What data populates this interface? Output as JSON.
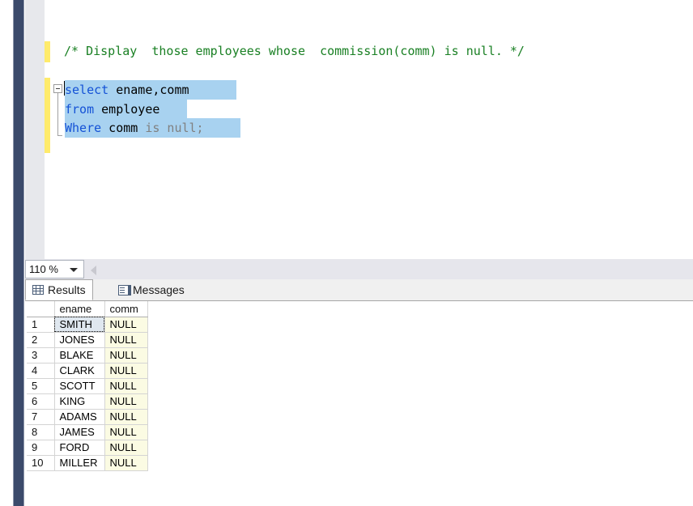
{
  "editor": {
    "comment": "/* Display  those employees whose  commission(comm) is null. */",
    "lines": [
      {
        "kw": "select",
        "rest": " ename,comm"
      },
      {
        "kw": "from",
        "rest": " employee"
      },
      {
        "kw": "Where",
        "rest": " comm ",
        "tail": "is null;"
      }
    ],
    "line1_keyword": "select",
    "line1_ident": " ename,comm",
    "line2_keyword": "from",
    "line2_ident": " employee",
    "line3_keyword": "Where",
    "line3_ident": " comm ",
    "line3_tail": "is null;",
    "fold_icon": "collapse-minus-icon"
  },
  "toolbar": {
    "zoom_value": "110 %",
    "zoom_dropdown_icon": "chevron-down-icon",
    "scroll_left_icon": "triangle-left-icon"
  },
  "tabs": [
    {
      "label": "Results",
      "icon": "grid-icon",
      "active": true
    },
    {
      "label": "Messages",
      "icon": "message-document-icon",
      "active": false
    }
  ],
  "results": {
    "columns": [
      "",
      "ename",
      "comm"
    ],
    "rows": [
      {
        "n": "1",
        "ename": "SMITH",
        "comm": "NULL"
      },
      {
        "n": "2",
        "ename": "JONES",
        "comm": "NULL"
      },
      {
        "n": "3",
        "ename": "BLAKE",
        "comm": "NULL"
      },
      {
        "n": "4",
        "ename": "CLARK",
        "comm": "NULL"
      },
      {
        "n": "5",
        "ename": "SCOTT",
        "comm": "NULL"
      },
      {
        "n": "6",
        "ename": "KING",
        "comm": "NULL"
      },
      {
        "n": "7",
        "ename": "ADAMS",
        "comm": "NULL"
      },
      {
        "n": "8",
        "ename": "JAMES",
        "comm": "NULL"
      },
      {
        "n": "9",
        "ename": "FORD",
        "comm": "NULL"
      },
      {
        "n": "10",
        "ename": "MILLER",
        "comm": "NULL"
      }
    ]
  },
  "colors": {
    "comment_green": "#1a8024",
    "keyword_blue": "#1452d6",
    "selection_blue": "#a8d2f0",
    "change_bar_yellow": "#ffeb6b",
    "null_cell_yellow": "#fbfbe3",
    "navy_bar": "#3b4a6b"
  }
}
